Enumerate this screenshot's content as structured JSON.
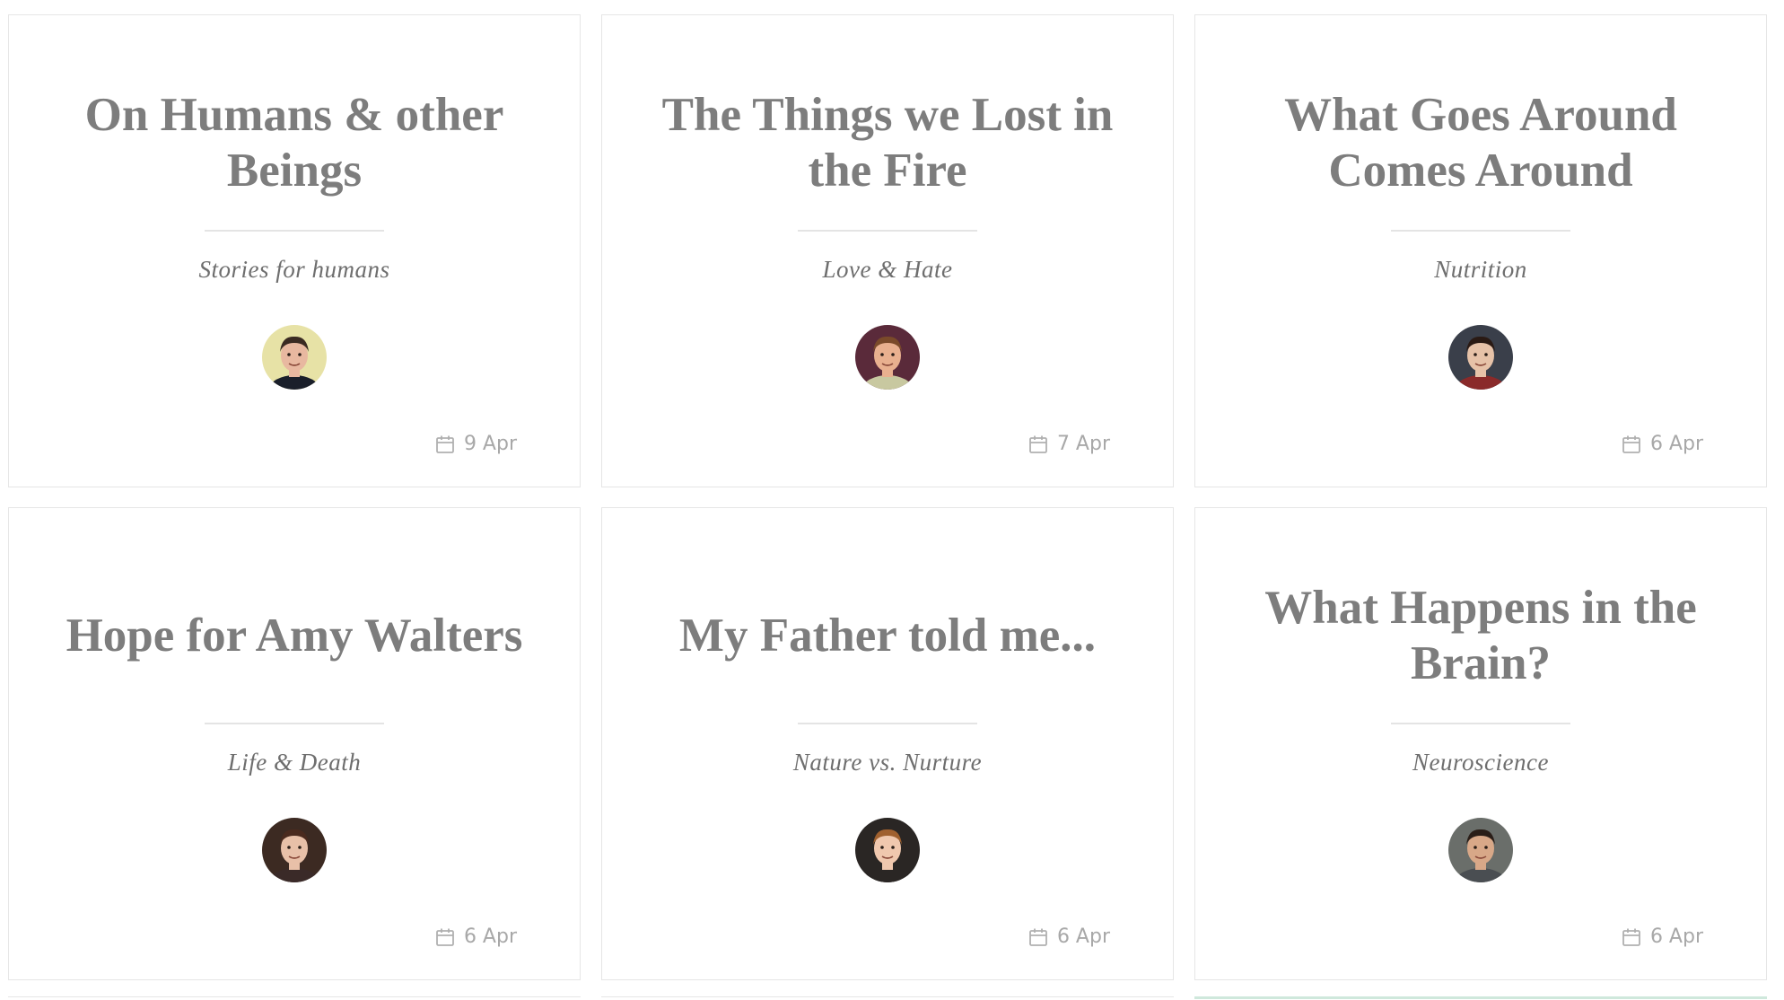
{
  "cards": [
    {
      "title": "On Humans & other Beings",
      "category": "Stories for humans",
      "date": "9 Apr",
      "avatar": {
        "bg": "#e7e2a6",
        "skin": "#e8b8a0",
        "hair": "#3a2a22",
        "shirt": "#1a1f2a"
      }
    },
    {
      "title": "The Things we Lost in the Fire",
      "category": "Love & Hate",
      "date": "7 Apr",
      "avatar": {
        "bg": "#5a2a3a",
        "skin": "#e9b08f",
        "hair": "#7a4a2a",
        "shirt": "#c8c8a0"
      }
    },
    {
      "title": "What Goes Around Comes Around",
      "category": "Nutrition",
      "date": "6 Apr",
      "avatar": {
        "bg": "#3a3f4a",
        "skin": "#e6c2a8",
        "hair": "#2a1a14",
        "shirt": "#8a2a2a"
      }
    },
    {
      "title": "Hope for Amy Walters",
      "category": "Life & Death",
      "date": "6 Apr",
      "avatar": {
        "bg": "#3c2a22",
        "skin": "#e8c0a8",
        "hair": "#4a2a1e",
        "shirt": "#3a2a28"
      }
    },
    {
      "title": "My Father told me...",
      "category": "Nature vs. Nurture",
      "date": "6 Apr",
      "avatar": {
        "bg": "#2a2624",
        "skin": "#f0c8ae",
        "hair": "#a0602e",
        "shirt": "#2a2624"
      }
    },
    {
      "title": "What Happens in the Brain?",
      "category": "Neuroscience",
      "date": "6 Apr",
      "avatar": {
        "bg": "#6a6e6a",
        "skin": "#d8a888",
        "hair": "#2a1e18",
        "shirt": "#4a4e52"
      }
    }
  ],
  "colors": {
    "title": "#7d7d7d",
    "category": "#6e6e6e",
    "date": "#a8a8a8",
    "border": "#e6e6e6"
  },
  "icons": {
    "date": "calendar-icon"
  }
}
